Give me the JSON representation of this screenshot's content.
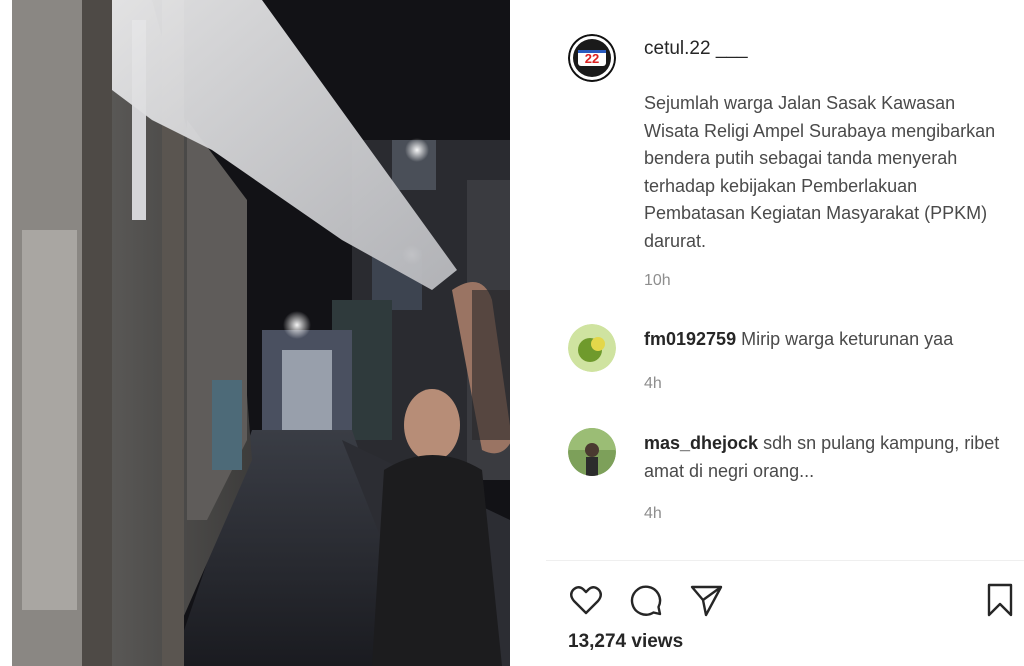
{
  "post": {
    "username": "cetul.22 ___",
    "avatar_icon": "logo-22-icon",
    "caption": "Sejumlah warga Jalan Sasak Kawasan Wisata Religi Ampel Surabaya mengibarkan bendera putih sebagai tanda menyerah terhadap kebijakan Pemberlakuan Pembatasan Kegiatan Masyarakat (PPKM) darurat.",
    "time": "10h"
  },
  "comments": [
    {
      "username": "fm0192759",
      "text": "Mirip warga keturunan yaa",
      "time": "4h"
    },
    {
      "username": "mas_dhejock",
      "text": "sdh sn pulang kampung, ribet amat di negri orang...",
      "time": "4h"
    }
  ],
  "actions": {
    "like_icon": "heart-icon",
    "comment_icon": "comment-icon",
    "share_icon": "send-icon",
    "save_icon": "bookmark-icon"
  },
  "stats": {
    "views": "13,274 views"
  },
  "colors": {
    "text_primary": "#262626",
    "text_secondary": "#8e8e8e",
    "video_background": "#0c0c0f"
  }
}
